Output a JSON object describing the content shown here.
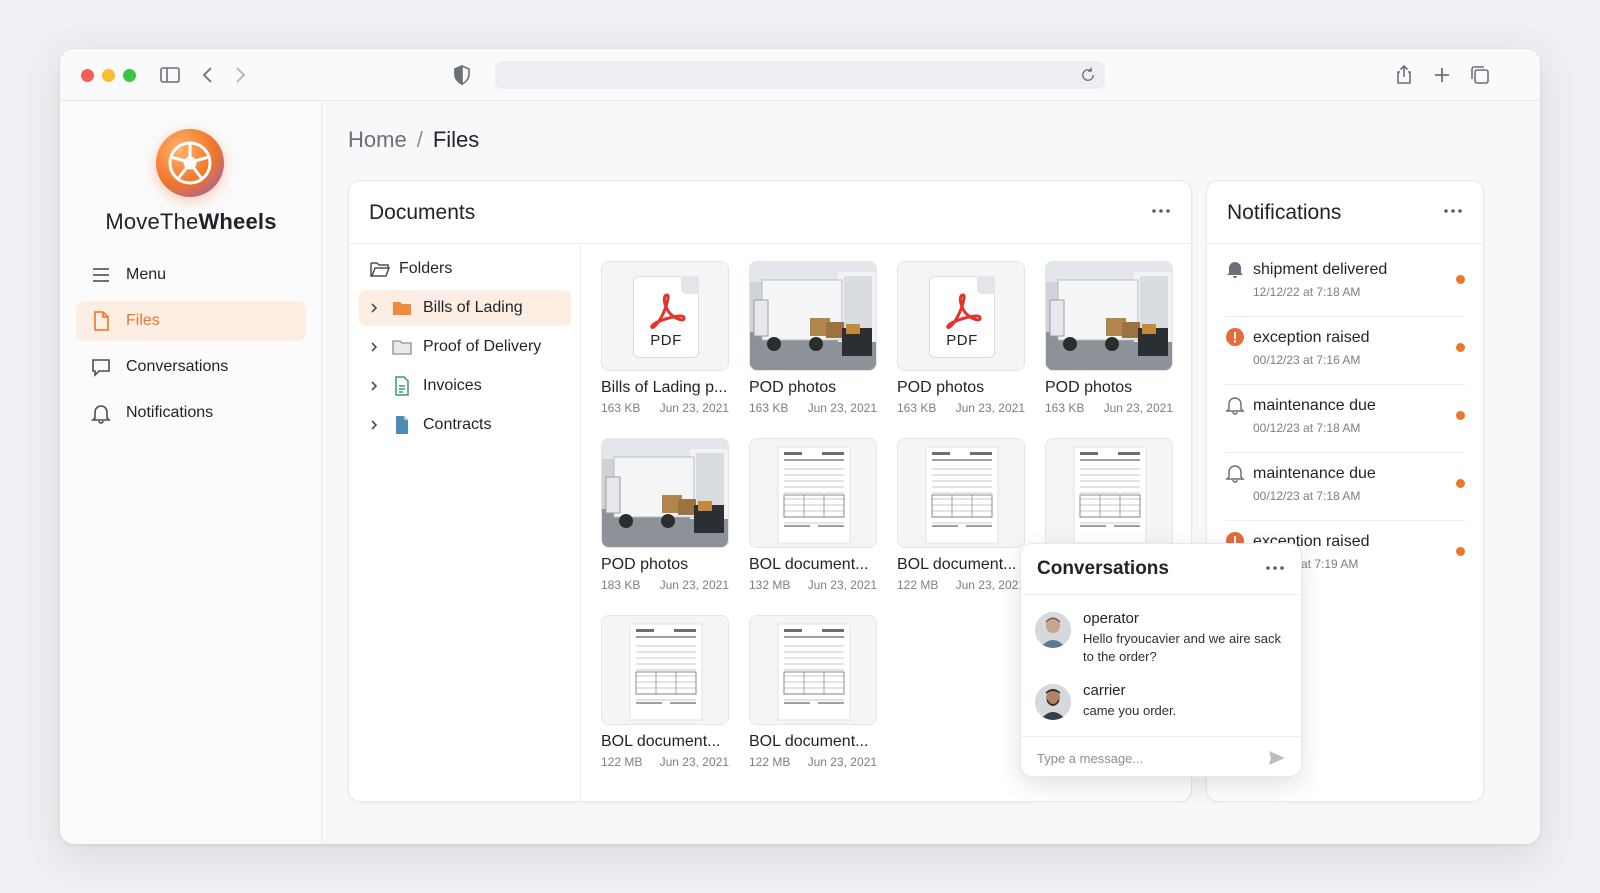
{
  "app": {
    "brand_prefix": "MoveThe",
    "brand_suffix": "Wheels",
    "accent_color": "#f0742a"
  },
  "sidebar": {
    "items": [
      {
        "label": "Menu",
        "icon": "hamburger-icon"
      },
      {
        "label": "Files",
        "icon": "file-icon",
        "active": true
      },
      {
        "label": "Conversations",
        "icon": "chat-bubble-icon"
      },
      {
        "label": "Notifications",
        "icon": "bell-icon"
      }
    ]
  },
  "breadcrumb": {
    "home": "Home",
    "separator": "/",
    "current": "Files"
  },
  "documents": {
    "title": "Documents",
    "folders_label": "Folders",
    "folders": [
      {
        "label": "Bills of Lading",
        "icon": "orange-folder-icon",
        "active": true
      },
      {
        "label": "Proof of Delivery",
        "icon": "gray-folder-icon"
      },
      {
        "label": "Invoices",
        "icon": "green-document-icon"
      },
      {
        "label": "Contracts",
        "icon": "blue-document-icon"
      }
    ],
    "files": [
      {
        "name": "Bills of Lading p...",
        "size": "163 KB",
        "date": "Jun 23, 2021",
        "thumb": "pdf"
      },
      {
        "name": "POD photos",
        "size": "163 KB",
        "date": "Jun 23, 2021",
        "thumb": "truck-photo"
      },
      {
        "name": "POD photos",
        "size": "163 KB",
        "date": "Jun 23, 2021",
        "thumb": "pdf"
      },
      {
        "name": "POD photos",
        "size": "163 KB",
        "date": "Jun 23, 2021",
        "thumb": "truck-photo"
      },
      {
        "name": "POD photos",
        "size": "183 KB",
        "date": "Jun 23, 2021",
        "thumb": "truck-photo"
      },
      {
        "name": "BOL document...",
        "size": "132 MB",
        "date": "Jun 23, 2021",
        "thumb": "document-scan"
      },
      {
        "name": "BOL document...",
        "size": "122 MB",
        "date": "Jun 23, 2021",
        "thumb": "document-scan"
      },
      {
        "name": "",
        "size": "",
        "date": "",
        "thumb": "document-scan"
      },
      {
        "name": "BOL document...",
        "size": "122 MB",
        "date": "Jun 23, 2021",
        "thumb": "document-scan"
      },
      {
        "name": "BOL document...",
        "size": "122 MB",
        "date": "Jun 23, 2021",
        "thumb": "document-scan"
      }
    ],
    "pdf_label": "PDF"
  },
  "notifications": {
    "title": "Notifications",
    "items": [
      {
        "title": "shipment delivered",
        "date": "12/12/22 at 7:18 AM",
        "icon": "filled-bell-icon"
      },
      {
        "title": "exception raised",
        "date": "00/12/23 at 7:16 AM",
        "icon": "alert-circle-icon"
      },
      {
        "title": "maintenance due",
        "date": "00/12/23 at 7:18 AM",
        "icon": "bell-icon"
      },
      {
        "title": "maintenance due",
        "date": "00/12/23 at 7:18 AM",
        "icon": "bell-icon"
      },
      {
        "title": "exception raised",
        "date": "at 7:19 AM",
        "icon": "alert-circle-icon"
      }
    ]
  },
  "conversations": {
    "title": "Conversations",
    "messages": [
      {
        "sender": "operator",
        "text": "Hello fryoucavier and we aire sack to the order?"
      },
      {
        "sender": "carrier",
        "text": "came you order."
      }
    ],
    "input_placeholder": "Type a message..."
  }
}
